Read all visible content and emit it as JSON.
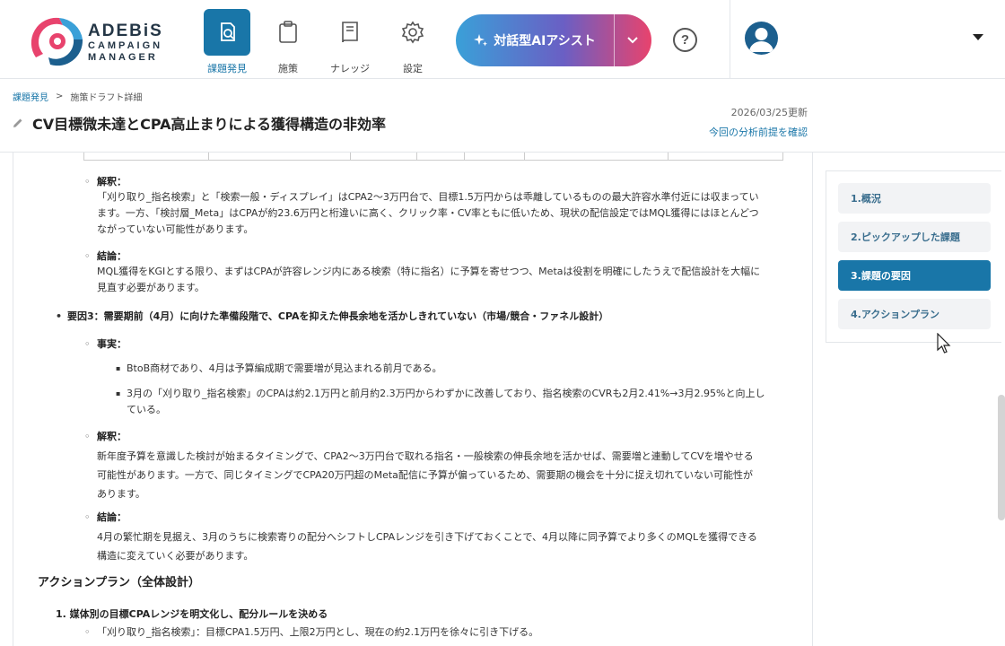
{
  "brand": {
    "name_line1": "ADEBiS",
    "name_line2": "CAMPAIGN",
    "name_line3": "MANAGER",
    "colors": {
      "primary": "#1976a8",
      "accent_red": "#e8436d",
      "accent_blue": "#3aa0d8"
    }
  },
  "nav": {
    "items": [
      {
        "label": "課題発見",
        "icon": "issue-search-icon",
        "active": true
      },
      {
        "label": "施策",
        "icon": "clipboard-icon",
        "active": false
      },
      {
        "label": "ナレッジ",
        "icon": "book-icon",
        "active": false
      },
      {
        "label": "設定",
        "icon": "gear-icon",
        "active": false
      }
    ]
  },
  "ai_assist": {
    "label": "対話型AIアシスト",
    "icon": "sparkle-icon"
  },
  "help": {
    "label": "?"
  },
  "breadcrumb": {
    "root": "課題発見",
    "separator": ">",
    "current": "施策ドラフト詳細"
  },
  "page": {
    "title": "CV目標微未達とCPA高止まりによる獲得構造の非効率",
    "updated": "2026/03/25更新",
    "premise_link": "今回の分析前提を確認"
  },
  "content": {
    "interp1_label": "解釈：",
    "interp1_text": [
      "「刈り取り_指名検索」と「検索一般・ディスプレイ」はCPA2〜3万円台で、目標1.5万円からは乖離しているものの最大許容水準付近には収まってい",
      "ます。一方、「検討層_Meta」はCPAが約23.6万円と桁違いに高く、クリック率・CV率ともに低いため、現状の配信設定ではMQL獲得にはほとんどつ",
      "ながっていない可能性があります。"
    ],
    "concl1_label": "結論：",
    "concl1_text": [
      "MQL獲得をKGIとする限り、まずはCPAが許容レンジ内にある検索（特に指名）に予算を寄せつつ、Metaは役割を明確にしたうえで配信設計を大幅に",
      "見直す必要があります。"
    ],
    "factor3": "要因3：需要期前（4月）に向けた準備段階で、CPAを抑えた伸長余地を活かしきれていない（市場/競合・ファネル設計）",
    "fact_label": "事実：",
    "fact1": "BtoB商材であり、4月は予算編成期で需要増が見込まれる前月である。",
    "fact2_l1": "3月の「刈り取り_指名検索」のCPAは約2.1万円と前月約2.3万円からわずかに改善しており、指名検索のCVRも2月2.41%→3月2.95%と向上し",
    "fact2_l2": "ている。",
    "interp2_label": "解釈：",
    "interp2_text": [
      "新年度予算を意識した検討が始まるタイミングで、CPA2〜3万円台で取れる指名・一般検索の伸長余地を活かせば、需要増と連動してCVを増やせる",
      "可能性があります。一方で、同じタイミングでCPA20万円超のMeta配信に予算が偏っているため、需要期の機会を十分に捉え切れていない可能性が",
      "あります。"
    ],
    "concl2_label": "結論：",
    "concl2_text": [
      "4月の繁忙期を見据え、3月のうちに検索寄りの配分へシフトしCPAレンジを引き下げておくことで、4月以降に同予算でより多くのMQLを獲得できる",
      "構造に変えていく必要があります。"
    ],
    "action_heading": "アクションプラン（全体設計）",
    "action1": "1. 媒体別の目標CPAレンジを明文化し、配分ルールを決める",
    "action1_sub": "「刈り取り_指名検索」：目標CPA1.5万円、上限2万円とし、現在の約2.1万円を徐々に引き下げる。"
  },
  "sidenav": {
    "items": [
      {
        "label": "1.概況",
        "active": false
      },
      {
        "label": "2.ピックアップした課題",
        "active": false
      },
      {
        "label": "3.課題の要因",
        "active": true
      },
      {
        "label": "4.アクションプラン",
        "active": false
      }
    ]
  }
}
